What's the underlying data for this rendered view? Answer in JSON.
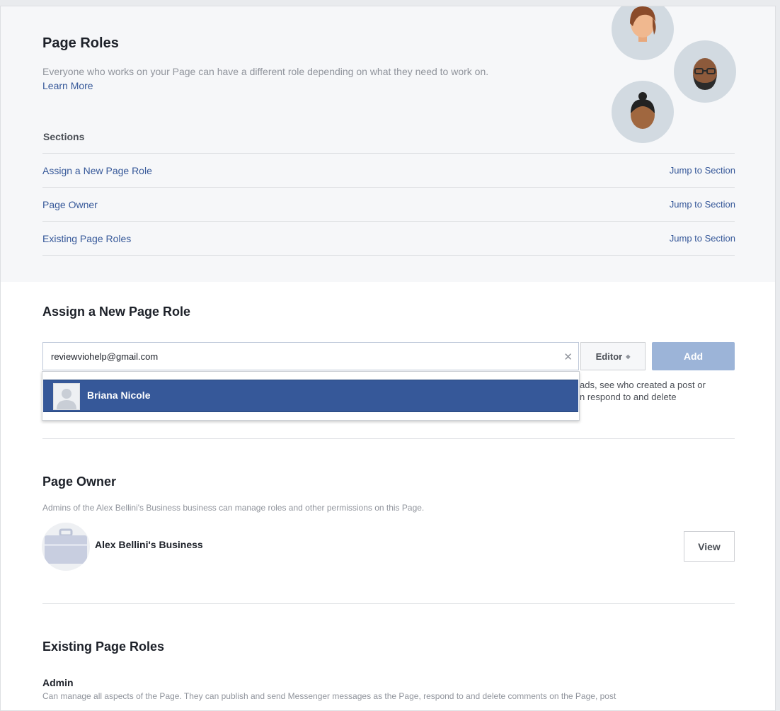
{
  "header": {
    "title": "Page Roles",
    "description": "Everyone who works on your Page can have a different role depending on what they need to work on.",
    "learn_more": "Learn More"
  },
  "sections": {
    "heading": "Sections",
    "items": [
      {
        "label": "Assign a New Page Role",
        "jump": "Jump to Section"
      },
      {
        "label": "Page Owner",
        "jump": "Jump to Section"
      },
      {
        "label": "Existing Page Roles",
        "jump": "Jump to Section"
      }
    ]
  },
  "assign": {
    "heading": "Assign a New Page Role",
    "input_value": "reviewviohelp@gmail.com",
    "role": "Editor",
    "add_label": "Add",
    "suggestion_name": "Briana Nicole",
    "partial_line1": "ads, see who created a post or",
    "partial_line2": "n respond to and delete"
  },
  "owner": {
    "heading": "Page Owner",
    "description": "Admins of the Alex Bellini's Business business can manage roles and other permissions on this Page.",
    "business_name": "Alex Bellini's Business",
    "view_label": "View"
  },
  "existing": {
    "heading": "Existing Page Roles",
    "role_name": "Admin",
    "role_desc": "Can manage all aspects of the Page. They can publish and send Messenger messages as the Page, respond to and delete comments on the Page, post"
  },
  "colors": {
    "link": "#365899",
    "add_button": "#9cb4d8",
    "highlight": "#365899",
    "avatar_bg": "#d2dae1"
  }
}
